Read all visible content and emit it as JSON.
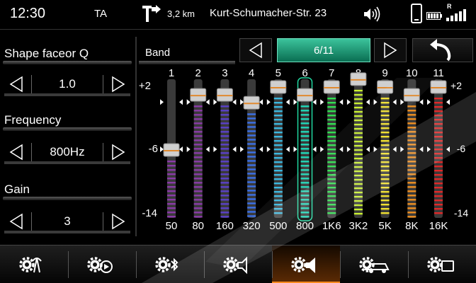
{
  "status": {
    "clock": "12:30",
    "ta": "TA",
    "distance": "3,2 km",
    "street": "Kurt-Schumacher-Str. 23",
    "roaming": "R"
  },
  "left": {
    "shape_label": "Shape faceor Q",
    "shape_value": "1.0",
    "frequency_label": "Frequency",
    "frequency_value": "800Hz",
    "gain_label": "Gain",
    "gain_value": "3"
  },
  "eq": {
    "band_label": "Band",
    "page": "6/11",
    "scale_top": "+2",
    "scale_mid": "-6",
    "scale_bottom": "-14",
    "scale_top_right": "+2",
    "scale_mid_right": "-6",
    "scale_bottom_right": "-14",
    "selected_band": 6,
    "bands": [
      {
        "num": "1",
        "freq": "50",
        "gain": -6,
        "color": "#8a3aa8"
      },
      {
        "num": "2",
        "freq": "80",
        "gain": 1,
        "color": "#8a3aa8"
      },
      {
        "num": "3",
        "freq": "160",
        "gain": 1,
        "color": "#5a40c8"
      },
      {
        "num": "4",
        "freq": "320",
        "gain": 0,
        "color": "#3a70e8"
      },
      {
        "num": "5",
        "freq": "500",
        "gain": 2,
        "color": "#3ab8e0"
      },
      {
        "num": "6",
        "freq": "800",
        "gain": 1,
        "color": "#20d8b8"
      },
      {
        "num": "7",
        "freq": "1K6",
        "gain": 2,
        "color": "#30e050"
      },
      {
        "num": "8",
        "freq": "3K2",
        "gain": 3,
        "color": "#c8f030"
      },
      {
        "num": "9",
        "freq": "5K",
        "gain": 2,
        "color": "#f0e030"
      },
      {
        "num": "10",
        "freq": "8K",
        "gain": 1,
        "color": "#f09020"
      },
      {
        "num": "11",
        "freq": "16K",
        "gain": 2,
        "color": "#e02828"
      }
    ]
  },
  "footer": {
    "buttons": [
      {
        "name": "sound-source-settings-button",
        "icon": "gear-antenna-icon"
      },
      {
        "name": "playback-settings-button",
        "icon": "gear-play-icon"
      },
      {
        "name": "bluetooth-settings-button",
        "icon": "gear-bluetooth-icon"
      },
      {
        "name": "speaker-settings-button",
        "icon": "gear-speaker-icon"
      },
      {
        "name": "equalizer-settings-button",
        "icon": "gear-speaker-active-icon",
        "active": true
      },
      {
        "name": "vehicle-settings-button",
        "icon": "gear-car-icon"
      },
      {
        "name": "display-settings-button",
        "icon": "gear-screen-icon"
      }
    ]
  },
  "colors": {
    "accent_green": "#3bc39b",
    "active_orange": "#ff8a1e"
  }
}
